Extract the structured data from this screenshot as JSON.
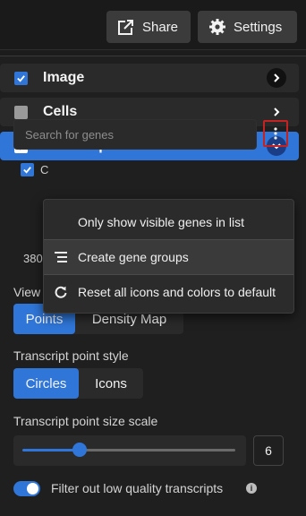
{
  "header": {
    "share_label": "Share",
    "settings_label": "Settings"
  },
  "layers": [
    {
      "label": "Image",
      "checked": true
    },
    {
      "label": "Cells",
      "checked": false
    },
    {
      "label": "Transcripts",
      "checked": true
    }
  ],
  "search": {
    "placeholder": "Search for genes"
  },
  "behind": {
    "checkbox_partial": "C",
    "count_partial": "380"
  },
  "view": {
    "label": "View",
    "options": [
      "Points",
      "Density Map"
    ],
    "selected": "Points"
  },
  "point_style": {
    "label": "Transcript point style",
    "options": [
      "Circles",
      "Icons"
    ],
    "selected": "Circles"
  },
  "size_scale": {
    "label": "Transcript point size scale",
    "value": "6",
    "fraction": 0.27
  },
  "filter": {
    "label": "Filter out low quality transcripts",
    "enabled": true
  },
  "menu": {
    "items": [
      {
        "label": "Only show visible genes in list",
        "icon": ""
      },
      {
        "label": "Create gene groups",
        "icon": "list-group-icon"
      },
      {
        "label": "Reset all icons and colors to default",
        "icon": "refresh-icon"
      }
    ]
  },
  "colors": {
    "accent": "#2f76d8",
    "highlight_border": "#c52222"
  }
}
